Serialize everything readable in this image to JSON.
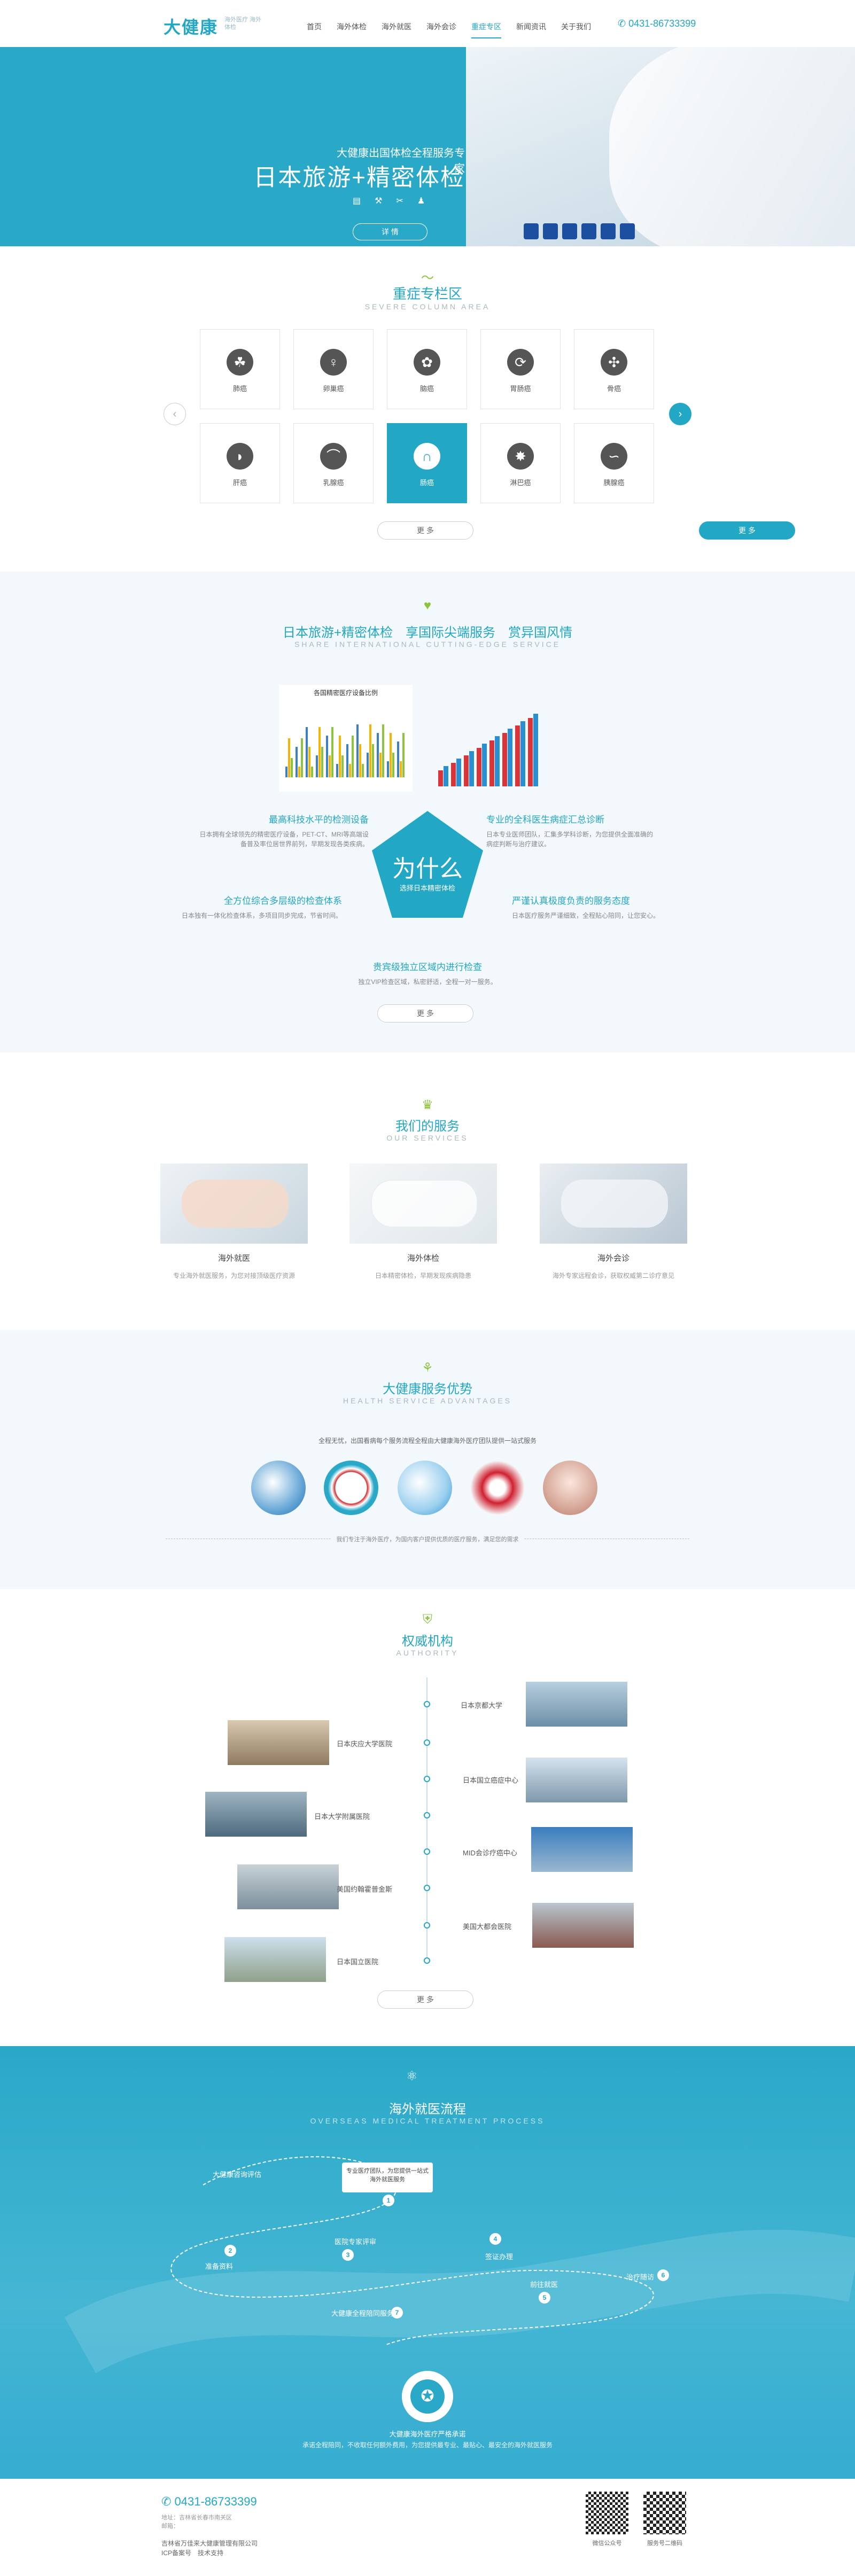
{
  "header": {
    "logo": "大健康",
    "logo_sub": "海外医疗 海外体检",
    "nav": [
      "首页",
      "海外体检",
      "海外就医",
      "海外会诊",
      "重症专区",
      "新闻资讯",
      "关于我们"
    ],
    "active_index": 4,
    "phone": "0431-86733399"
  },
  "banner": {
    "subtitle": "大健康出国体检全程服务专家",
    "title": "日本旅游+精密体检",
    "icons": [
      "document-icon",
      "tools-icon",
      "wrench-icon",
      "user-icon"
    ],
    "button": "详 情"
  },
  "area": {
    "title": "重症专栏区",
    "subtitle": "SEVERE COLUMN AREA",
    "items": [
      {
        "label": "肺癌",
        "icon": "lung-icon"
      },
      {
        "label": "卵巢癌",
        "icon": "ovary-icon"
      },
      {
        "label": "脑癌",
        "icon": "brain-icon"
      },
      {
        "label": "胃肠癌",
        "icon": "stomach-icon"
      },
      {
        "label": "骨癌",
        "icon": "bone-icon"
      },
      {
        "label": "肝癌",
        "icon": "liver-icon"
      },
      {
        "label": "乳腺癌",
        "icon": "breast-icon"
      },
      {
        "label": "肠癌",
        "icon": "intestine-icon"
      },
      {
        "label": "淋巴癌",
        "icon": "lymph-icon"
      },
      {
        "label": "胰腺癌",
        "icon": "pancreas-icon"
      }
    ],
    "active_index": 7,
    "more": "更 多",
    "more2": "更 多"
  },
  "why": {
    "title": "日本旅游+精密体检　享国际尖端服务　赏异国风情",
    "subtitle": "SHARE INTERNATIONAL CUTTING-EDGE SERVICE",
    "chart1_title": "各国精密医疗设备比例",
    "chart2_title": "",
    "center_big": "为什么",
    "center_small": "选择日本精密体检",
    "items": [
      {
        "title": "最高科技水平的检测设备",
        "desc": "日本拥有全球领先的精密医疗设备，PET-CT、MRI等高端设备普及率位居世界前列，早期发现各类疾病。"
      },
      {
        "title": "专业的全科医生病症汇总诊断",
        "desc": "日本专业医师团队，汇集多学科诊断，为您提供全面准确的病症判断与治疗建议。"
      },
      {
        "title": "全方位综合多层级的检查体系",
        "desc": "日本独有一体化检查体系，多项目同步完成，节省时间。"
      },
      {
        "title": "严谨认真极度负责的服务态度",
        "desc": "日本医疗服务严谨细致，全程贴心陪同，让您安心。"
      },
      {
        "title": "贵宾级独立区域内进行检查",
        "desc": "独立VIP检查区域，私密舒适，全程一对一服务。"
      }
    ],
    "more": "更 多"
  },
  "services": {
    "title": "我们的服务",
    "subtitle": "OUR SERVICES",
    "items": [
      {
        "name": "海外就医",
        "desc": "专业海外就医服务，为您对接顶级医疗资源"
      },
      {
        "name": "海外体检",
        "desc": "日本精密体检，早期发现疾病隐患"
      },
      {
        "name": "海外会诊",
        "desc": "海外专家远程会诊，获取权威第二诊疗意见"
      }
    ]
  },
  "advantages": {
    "title": "大健康服务优势",
    "subtitle": "HEALTH SERVICE ADVANTAGES",
    "intro": "全程无忧，出国看病每个服务流程全程由大健康海外医疗团队提供一站式服务",
    "note": "我们专注于海外医疗，为国内客户提供优质的医疗服务，满足您的需求"
  },
  "authority": {
    "title": "权威机构",
    "subtitle": "AUTHORITY",
    "right": [
      "日本京都大学",
      "日本国立癌症中心",
      "MID会诊疗癌中心",
      "美国大都会医院"
    ],
    "left": [
      "日本庆应大学医院",
      "日本大学附属医院",
      "美国约翰霍普金斯",
      "日本国立医院"
    ],
    "more": "更 多"
  },
  "process": {
    "title": "海外就医流程",
    "subtitle": "OVERSEAS MEDICAL TREATMENT PROCESS",
    "callout": "专业医疗团队，为您提供一站式海外就医服务",
    "steps": [
      "大健康咨询评估",
      "准备资料",
      "医院专家评审",
      "签证办理",
      "前往就医",
      "治疗随访",
      "大健康全程陪同服务"
    ],
    "bottom_title": "大健康海外医疗严格承诺",
    "bottom_desc": "承诺全程陪同，不收取任何额外费用，为您提供最专业、最贴心、最安全的海外就医服务"
  },
  "footer": {
    "phone": "0431-86733399",
    "address": "地址：吉林省长春市南关区",
    "email": "邮箱：",
    "company": "吉林省万佳来大健康管理有限公司",
    "icp": "ICP备案号　技术支持",
    "qr1": "微信公众号",
    "qr2": "服务号二维码"
  }
}
